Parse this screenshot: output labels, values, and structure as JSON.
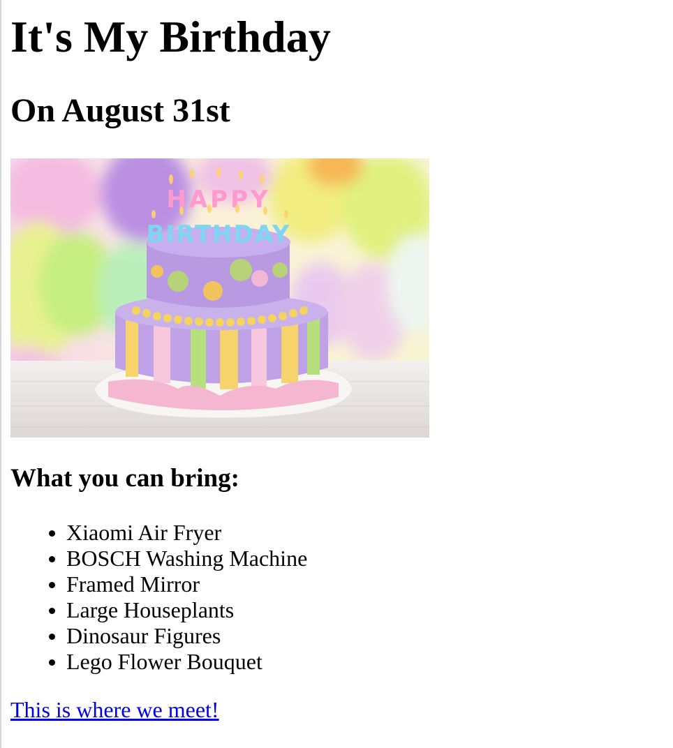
{
  "heading": "It's My Birthday",
  "subheading": "On August 31st",
  "image": {
    "alt": "Happy Birthday cake",
    "candle_text": [
      "HAPPY",
      "BIRTHDAY"
    ]
  },
  "bring_heading": "What you can bring:",
  "items": [
    "Xiaomi Air Fryer",
    "BOSCH Washing Machine",
    "Framed Mirror",
    "Large Houseplants",
    "Dinosaur Figures",
    "Lego Flower Bouquet"
  ],
  "meet_link": "This is where we meet!"
}
